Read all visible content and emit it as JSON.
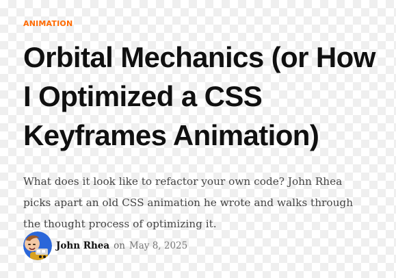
{
  "post": {
    "category": "ANIMATION",
    "title": "Orbital Mechanics (or How I Optimized a CSS Keyframes Animation)",
    "excerpt": "What does it look like to refactor your own code? John Rhea picks apart an old CSS animation he wrote and walks through the thought process of optimizing it.",
    "author": "John Rhea",
    "date_prefix": "on",
    "date": "May 8, 2025"
  },
  "colors": {
    "accent": "#ff6a00",
    "title": "#101010",
    "excerpt": "#444444"
  },
  "icons": {
    "avatar": "author-avatar"
  }
}
